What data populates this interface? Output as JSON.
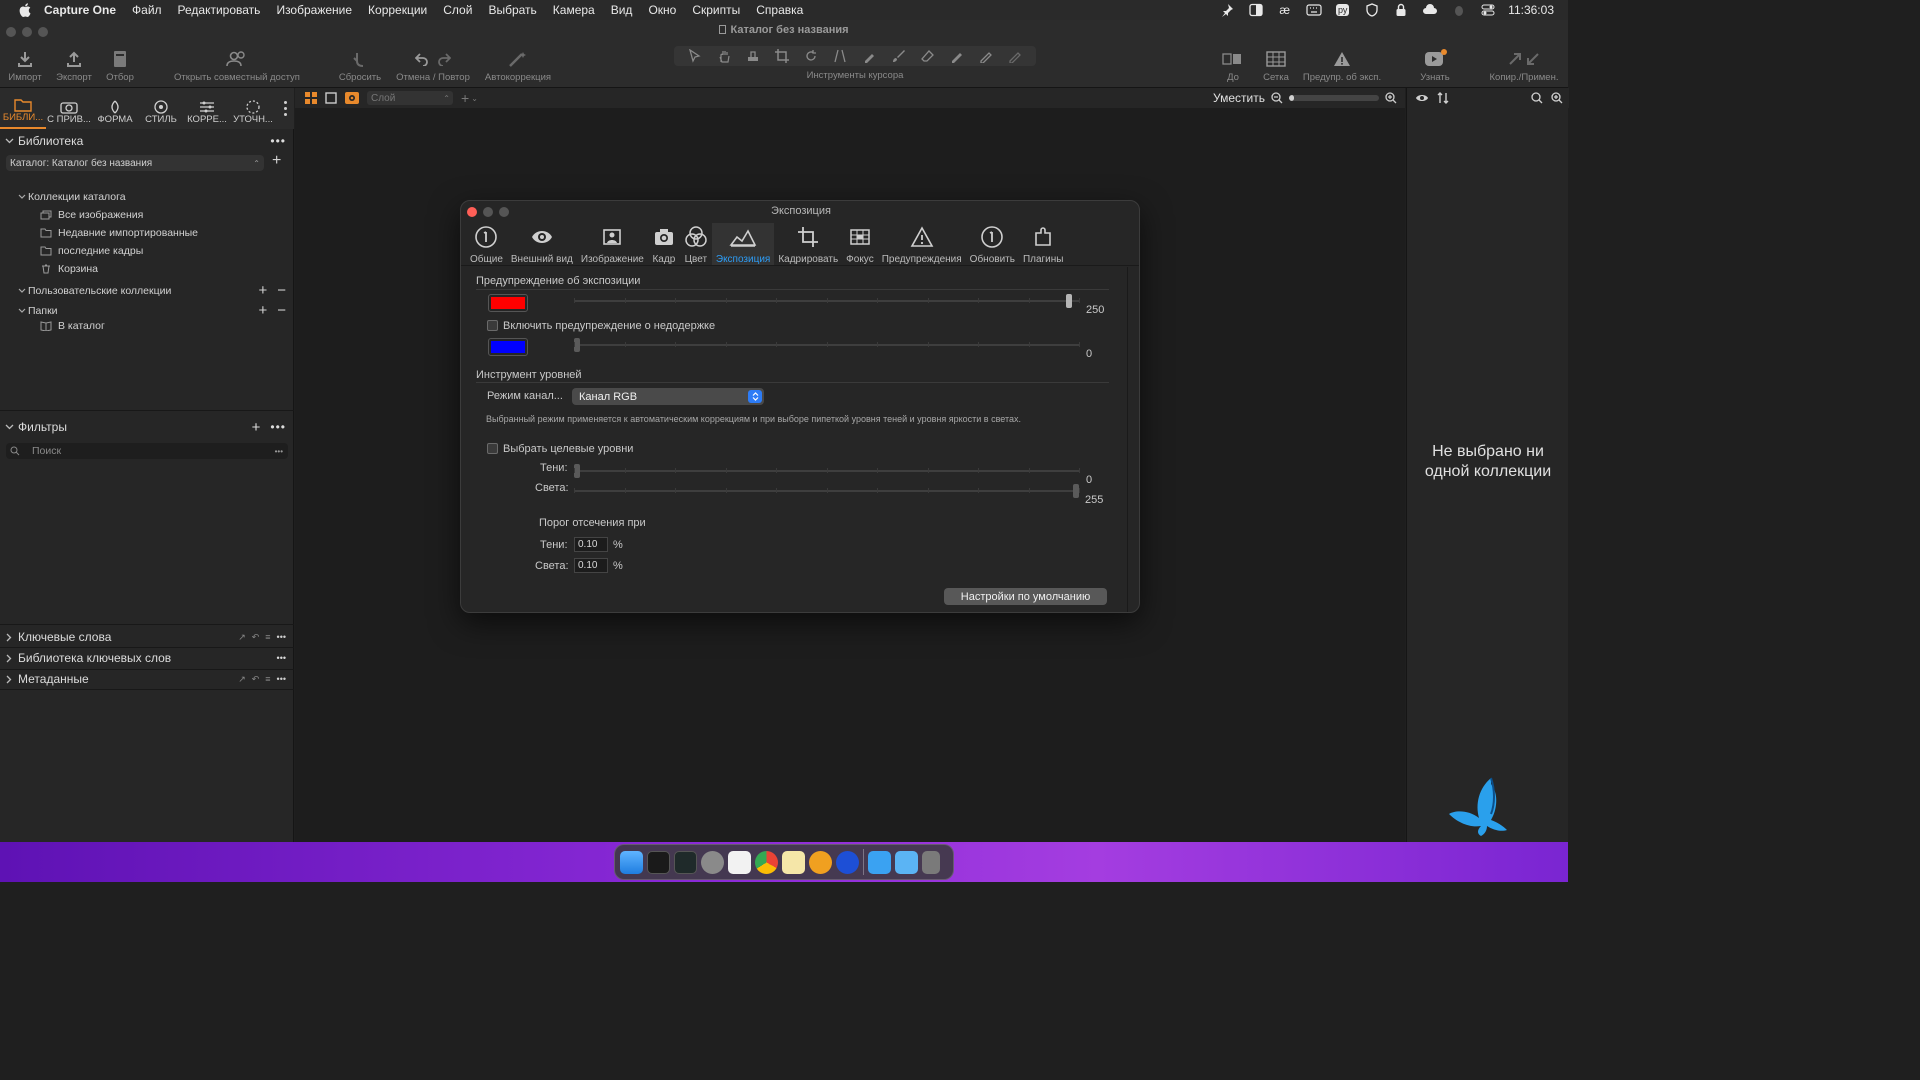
{
  "menubar": {
    "app": "Capture One",
    "items": [
      "Файл",
      "Редактировать",
      "Изображение",
      "Коррекции",
      "Слой",
      "Выбрать",
      "Камера",
      "Вид",
      "Окно",
      "Скрипты",
      "Справка"
    ],
    "time": "11:36:03",
    "lang": "ру"
  },
  "window": {
    "title": "Каталог без названия"
  },
  "toolbar": {
    "import": "Импорт",
    "export": "Экспорт",
    "cull": "Отбор",
    "share": "Открыть совместный доступ",
    "reset": "Сбросить",
    "undo_redo": "Отмена / Повтор",
    "autocorr": "Автокоррекция",
    "cursor_tools": "Инструменты курсора",
    "before": "До",
    "grid": "Сетка",
    "exposure_warning": "Предупр. об эксп.",
    "learn": "Узнать",
    "copy_apply": "Копир./Примен."
  },
  "tool_tabs": [
    "БИБЛИ...",
    "С ПРИВ...",
    "ФОРМА",
    "СТИЛЬ",
    "КОРРЕ...",
    "УТОЧН..."
  ],
  "library": {
    "title": "Библиотека",
    "catalog_select": "Каталог: Каталог без названия",
    "catalog_collections": "Коллекции каталога",
    "items": [
      "Все изображения",
      "Недавние импортированные",
      "последние кадры",
      "Корзина"
    ],
    "user_collections": "Пользовательские коллекции",
    "folders": "Папки",
    "in_catalog": "В каталог"
  },
  "filters": {
    "title": "Фильтры",
    "search_placeholder": "Поиск"
  },
  "bottom_sections": [
    "Ключевые слова",
    "Библиотека ключевых слов",
    "Метаданные"
  ],
  "viewer": {
    "layer": "Слой",
    "fit": "Уместить",
    "zoom_fraction": 0.06
  },
  "right_panel": {
    "empty": "Не выбрано ни одной коллекции"
  },
  "prefs": {
    "title": "Экспозиция",
    "tabs": [
      "Общие",
      "Внешний вид",
      "Изображение",
      "Кадр",
      "Цвет",
      "Экспозиция",
      "Кадрировать",
      "Фокус",
      "Предупреждения",
      "Обновить",
      "Плагины"
    ],
    "active_tab": 5,
    "warning_section": "Предупреждение об экспозиции",
    "over_color": "#ff0000",
    "over_value": "250",
    "over_fraction": 0.98,
    "under_label": "Включить предупреждение о недодержке",
    "under_color": "#0000ff",
    "under_value": "0",
    "levels_section": "Инструмент уровней",
    "channel_label": "Режим канал...",
    "channel_value": "Канал RGB",
    "channel_note": "Выбранный режим применяется к автоматическим коррекциям и при выборе пипеткой уровня теней и уровня яркости в светах.",
    "target_label": "Выбрать целевые уровни",
    "shadows_label": "Тени:",
    "highlights_label": "Света:",
    "shadows_value": "0",
    "highlights_value": "255",
    "clip_title": "Порог отсечения при",
    "clip_shadows": "0.10",
    "clip_highlights": "0.10",
    "percent": "%",
    "defaults_button": "Настройки по умолчанию"
  }
}
